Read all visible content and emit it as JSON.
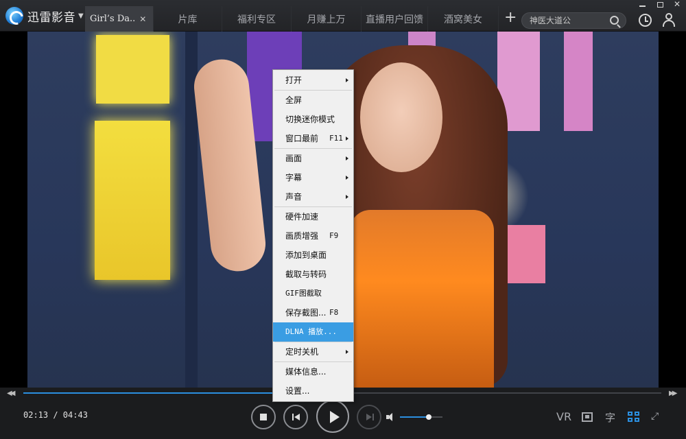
{
  "app": {
    "title": "迅雷影音"
  },
  "tabs": [
    {
      "label": "Girl’s Da..",
      "active": true
    },
    {
      "label": "片库"
    },
    {
      "label": "福利专区"
    },
    {
      "label": "月赚上万"
    },
    {
      "label": "直播用户回馈"
    },
    {
      "label": "酒窝美女"
    }
  ],
  "search": {
    "placeholder": "神医大道公"
  },
  "context_menu": {
    "groups": [
      [
        {
          "label": "打开",
          "submenu": true
        }
      ],
      [
        {
          "label": "全屏"
        },
        {
          "label": "切换迷你模式"
        },
        {
          "label": "窗口最前",
          "shortcut": "F11",
          "submenu": true
        }
      ],
      [
        {
          "label": "画面",
          "submenu": true
        },
        {
          "label": "字幕",
          "submenu": true
        },
        {
          "label": "声音",
          "submenu": true
        }
      ],
      [
        {
          "label": "硬件加速"
        },
        {
          "label": "画质增强",
          "shortcut": "F9"
        },
        {
          "label": "添加到桌面"
        },
        {
          "label": "截取与转码"
        },
        {
          "label": "GIF图截取"
        },
        {
          "label": "保存截图...",
          "shortcut": "F8"
        },
        {
          "label": "DLNA 播放...",
          "highlighted": true
        }
      ],
      [
        {
          "label": "定时关机",
          "submenu": true
        }
      ],
      [
        {
          "label": "媒体信息..."
        },
        {
          "label": "设置..."
        }
      ]
    ]
  },
  "player": {
    "time_current": "02:13",
    "time_total": "04:43",
    "time_display": "02:13 / 04:43",
    "progress_fraction": 0.47,
    "volume_fraction": 0.68,
    "vr_label": "VR",
    "subtitle_label": "字"
  },
  "colors": {
    "accent": "#2b8fe0",
    "menu_highlight": "#3a9de3",
    "background": "#1b1c1e"
  },
  "icons": {
    "logo": "xunlei-logo-icon",
    "search": "search-icon",
    "history": "clock-history-icon",
    "user": "user-icon",
    "volume": "speaker-icon",
    "fullscreen": "expand-icon"
  }
}
